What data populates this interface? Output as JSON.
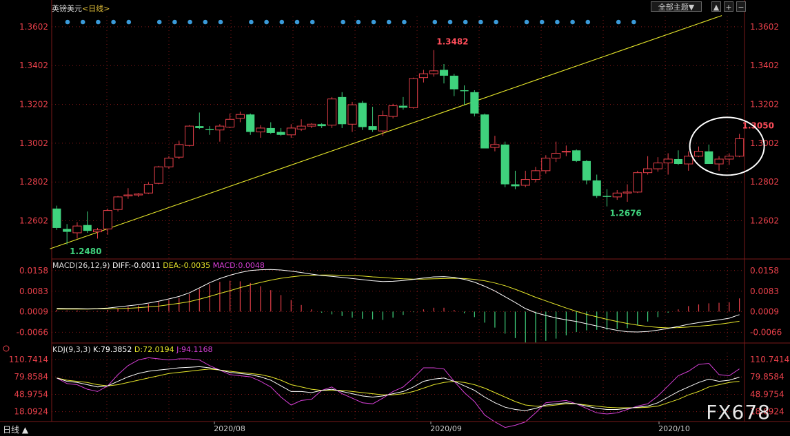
{
  "header": {
    "symbol": "英镑美元",
    "period_tag": "<日线>",
    "theme_button": "全部主题▼",
    "buttons": [
      "▲",
      "+",
      "−"
    ]
  },
  "macd_header": {
    "label": "MACD(26,12,9)",
    "diff": "DIFF:-0.0011",
    "dea": "DEA:-0.0035",
    "macd": "MACD:0.0048"
  },
  "kdj_header": {
    "label": "KDJ(9,3,3)",
    "k": "K:79.3852",
    "d": "D:72.0194",
    "j": "J:94.1168"
  },
  "footer": {
    "period": "日线 ▲",
    "x_ticks": [
      "2020/08",
      "2020/09",
      "2020/10"
    ]
  },
  "watermark": "FX678",
  "colors": {
    "up": "#e8404a",
    "down": "#3fd27d",
    "trend": "#e6e62a",
    "diff": "#ffffff",
    "dea": "#e6e62a",
    "k_line": "#ffffff",
    "d_line": "#e6e62a",
    "j_line": "#d63fd6",
    "axis_label": "#e8404a",
    "dots": "#3a9ad9"
  },
  "chart_data": [
    {
      "type": "candlestick",
      "title": "英镑美元",
      "x_ticks": [
        "2020/08",
        "2020/09",
        "2020/10"
      ],
      "y_ticks": [
        "1.3602",
        "1.3402",
        "1.3202",
        "1.3002",
        "1.2802",
        "1.2602"
      ],
      "ylim": [
        1.2405,
        1.3655
      ],
      "annotations": [
        {
          "text": "1.3482",
          "type": "high"
        },
        {
          "text": "1.2480",
          "type": "low"
        },
        {
          "text": "1.2676",
          "type": "low"
        },
        {
          "text": "1.3050",
          "type": "high",
          "circled": true
        }
      ],
      "trendline": {
        "from": [
          0,
          1.25
        ],
        "to": [
          65,
          1.366
        ]
      },
      "ohlc": [
        [
          1.2665,
          1.268,
          1.2555,
          1.2565
        ],
        [
          1.256,
          1.2585,
          1.248,
          1.2545
        ],
        [
          1.254,
          1.2595,
          1.251,
          1.2575
        ],
        [
          1.258,
          1.265,
          1.254,
          1.255
        ],
        [
          1.2545,
          1.2565,
          1.251,
          1.2555
        ],
        [
          1.256,
          1.2665,
          1.253,
          1.2655
        ],
        [
          1.266,
          1.273,
          1.265,
          1.2725
        ],
        [
          1.273,
          1.277,
          1.2715,
          1.2735
        ],
        [
          1.2735,
          1.2745,
          1.2725,
          1.274
        ],
        [
          1.2745,
          1.28,
          1.274,
          1.279
        ],
        [
          1.2795,
          1.2885,
          1.279,
          1.288
        ],
        [
          1.288,
          1.2935,
          1.287,
          1.2925
        ],
        [
          1.293,
          1.3015,
          1.292,
          1.2995
        ],
        [
          1.299,
          1.3095,
          1.2985,
          1.309
        ],
        [
          1.309,
          1.316,
          1.3075,
          1.308
        ],
        [
          1.3075,
          1.309,
          1.3045,
          1.307
        ],
        [
          1.307,
          1.31,
          1.301,
          1.309
        ],
        [
          1.3085,
          1.3155,
          1.308,
          1.3125
        ],
        [
          1.313,
          1.3165,
          1.311,
          1.315
        ],
        [
          1.315,
          1.3155,
          1.3045,
          1.306
        ],
        [
          1.306,
          1.3095,
          1.303,
          1.308
        ],
        [
          1.308,
          1.311,
          1.305,
          1.3055
        ],
        [
          1.306,
          1.308,
          1.304,
          1.3045
        ],
        [
          1.3045,
          1.31,
          1.303,
          1.308
        ],
        [
          1.3075,
          1.3125,
          1.3065,
          1.309
        ],
        [
          1.309,
          1.3105,
          1.308,
          1.31
        ],
        [
          1.31,
          1.3105,
          1.308,
          1.309
        ],
        [
          1.3095,
          1.324,
          1.308,
          1.323
        ],
        [
          1.324,
          1.3265,
          1.308,
          1.31
        ],
        [
          1.31,
          1.3215,
          1.306,
          1.32
        ],
        [
          1.321,
          1.322,
          1.307,
          1.3085
        ],
        [
          1.309,
          1.319,
          1.306,
          1.307
        ],
        [
          1.3065,
          1.317,
          1.304,
          1.3145
        ],
        [
          1.314,
          1.3205,
          1.313,
          1.3195
        ],
        [
          1.3195,
          1.324,
          1.3175,
          1.3185
        ],
        [
          1.3185,
          1.334,
          1.318,
          1.3335
        ],
        [
          1.334,
          1.338,
          1.3315,
          1.336
        ],
        [
          1.336,
          1.3482,
          1.3345,
          1.3375
        ],
        [
          1.338,
          1.341,
          1.331,
          1.335
        ],
        [
          1.335,
          1.336,
          1.3245,
          1.328
        ],
        [
          1.3275,
          1.33,
          1.32,
          1.327
        ],
        [
          1.3265,
          1.3275,
          1.314,
          1.3155
        ],
        [
          1.315,
          1.3155,
          1.298,
          1.2975
        ],
        [
          1.298,
          1.304,
          1.296,
          1.2995
        ],
        [
          1.2995,
          1.301,
          1.2775,
          1.279
        ],
        [
          1.279,
          1.286,
          1.2765,
          1.278
        ],
        [
          1.2785,
          1.286,
          1.2775,
          1.2815
        ],
        [
          1.2815,
          1.288,
          1.28,
          1.286
        ],
        [
          1.286,
          1.294,
          1.2845,
          1.2925
        ],
        [
          1.2925,
          1.301,
          1.2905,
          1.295
        ],
        [
          1.296,
          1.299,
          1.2935,
          1.296
        ],
        [
          1.2965,
          1.297,
          1.2905,
          1.291
        ],
        [
          1.291,
          1.2915,
          1.279,
          1.281
        ],
        [
          1.281,
          1.284,
          1.272,
          1.273
        ],
        [
          1.273,
          1.2765,
          1.2676,
          1.2725
        ],
        [
          1.2725,
          1.276,
          1.271,
          1.2745
        ],
        [
          1.2745,
          1.279,
          1.27,
          1.275
        ],
        [
          1.275,
          1.286,
          1.2745,
          1.285
        ],
        [
          1.285,
          1.2935,
          1.284,
          1.287
        ],
        [
          1.287,
          1.293,
          1.2855,
          1.29
        ],
        [
          1.29,
          1.295,
          1.284,
          1.292
        ],
        [
          1.292,
          1.2965,
          1.289,
          1.2895
        ],
        [
          1.2895,
          1.296,
          1.286,
          1.2935
        ],
        [
          1.2935,
          1.2985,
          1.293,
          1.296
        ],
        [
          1.296,
          1.2995,
          1.2905,
          1.2895
        ],
        [
          1.2895,
          1.2935,
          1.286,
          1.292
        ],
        [
          1.292,
          1.295,
          1.289,
          1.2935
        ],
        [
          1.2935,
          1.305,
          1.293,
          1.3025
        ]
      ]
    },
    {
      "type": "macd",
      "y_ticks": [
        "0.0158",
        "0.0083",
        "0.0009",
        "-0.0066"
      ],
      "ylim": [
        -0.01,
        0.017
      ],
      "diff": [
        0.0012,
        0.0011,
        0.0011,
        0.001,
        0.0011,
        0.0013,
        0.0017,
        0.0021,
        0.0025,
        0.0031,
        0.0038,
        0.0046,
        0.0055,
        0.0068,
        0.0086,
        0.0105,
        0.012,
        0.0132,
        0.0142,
        0.0149,
        0.0152,
        0.0153,
        0.0151,
        0.0147,
        0.0142,
        0.0136,
        0.0131,
        0.0128,
        0.0124,
        0.012,
        0.0116,
        0.0112,
        0.0109,
        0.011,
        0.0113,
        0.0117,
        0.0122,
        0.0126,
        0.0127,
        0.0124,
        0.0117,
        0.0107,
        0.0092,
        0.0075,
        0.0054,
        0.0033,
        0.0011,
        -0.0004,
        -0.0014,
        -0.0023,
        -0.003,
        -0.0036,
        -0.0044,
        -0.0052,
        -0.0061,
        -0.0068,
        -0.0073,
        -0.0074,
        -0.0072,
        -0.0067,
        -0.0061,
        -0.0054,
        -0.0046,
        -0.004,
        -0.0035,
        -0.003,
        -0.0024,
        -0.0011
      ],
      "dea": [
        0.0009,
        0.0009,
        0.0009,
        0.0009,
        0.001,
        0.001,
        0.0011,
        0.0012,
        0.0014,
        0.0017,
        0.002,
        0.0025,
        0.003,
        0.0036,
        0.0045,
        0.0055,
        0.0066,
        0.0076,
        0.0087,
        0.0097,
        0.0106,
        0.0114,
        0.0121,
        0.0126,
        0.013,
        0.0132,
        0.0133,
        0.0133,
        0.0132,
        0.0131,
        0.0129,
        0.0126,
        0.0124,
        0.0121,
        0.0119,
        0.0118,
        0.0118,
        0.0119,
        0.012,
        0.0121,
        0.012,
        0.0117,
        0.0112,
        0.0104,
        0.0094,
        0.0081,
        0.0067,
        0.0052,
        0.0039,
        0.0026,
        0.0013,
        0.0001,
        -0.001,
        -0.0019,
        -0.0028,
        -0.0036,
        -0.0043,
        -0.0049,
        -0.0054,
        -0.0057,
        -0.0059,
        -0.0058,
        -0.0056,
        -0.0053,
        -0.005,
        -0.0046,
        -0.0041,
        -0.0035
      ],
      "macd": [
        0.0006,
        0.0004,
        0.0004,
        0.0002,
        0.0002,
        0.0006,
        0.0012,
        0.0018,
        0.0022,
        0.0028,
        0.0036,
        0.0042,
        0.005,
        0.0064,
        0.0082,
        0.01,
        0.0108,
        0.0112,
        0.011,
        0.0104,
        0.0092,
        0.0078,
        0.006,
        0.0042,
        0.0024,
        0.0008,
        -0.0004,
        -0.001,
        -0.0016,
        -0.0022,
        -0.0026,
        -0.0028,
        -0.003,
        -0.0022,
        -0.0012,
        -0.0002,
        0.0008,
        0.0014,
        0.0014,
        0.0006,
        -0.0006,
        -0.002,
        -0.004,
        -0.0058,
        -0.008,
        -0.0096,
        -0.0112,
        -0.0112,
        -0.0106,
        -0.0098,
        -0.0086,
        -0.0074,
        -0.0068,
        -0.0066,
        -0.0066,
        -0.0064,
        -0.006,
        -0.005,
        -0.0036,
        -0.002,
        -0.0004,
        0.0008,
        0.002,
        0.0026,
        0.003,
        0.0032,
        0.0034,
        0.0048
      ]
    },
    {
      "type": "kdj",
      "y_ticks": [
        "110.7414",
        "79.8584",
        "48.9754",
        "18.0924"
      ],
      "ylim": [
        3,
        123
      ],
      "k": [
        78,
        72,
        70,
        66,
        62,
        64,
        72,
        80,
        86,
        90,
        92,
        94,
        96,
        97,
        98,
        96,
        92,
        88,
        86,
        84,
        80,
        74,
        64,
        54,
        54,
        52,
        56,
        58,
        54,
        50,
        46,
        44,
        46,
        50,
        54,
        62,
        72,
        76,
        78,
        72,
        64,
        56,
        44,
        34,
        26,
        22,
        20,
        24,
        30,
        32,
        34,
        32,
        28,
        24,
        22,
        22,
        24,
        26,
        28,
        34,
        44,
        54,
        62,
        70,
        76,
        72,
        74,
        79.4
      ],
      "d": [
        78,
        74,
        72,
        70,
        66,
        64,
        66,
        70,
        74,
        78,
        82,
        86,
        88,
        90,
        92,
        94,
        92,
        90,
        88,
        86,
        84,
        80,
        74,
        66,
        62,
        58,
        56,
        56,
        56,
        54,
        52,
        50,
        48,
        48,
        50,
        54,
        60,
        66,
        70,
        72,
        70,
        66,
        60,
        52,
        44,
        36,
        30,
        28,
        28,
        30,
        32,
        32,
        30,
        28,
        26,
        25,
        25,
        25,
        26,
        28,
        34,
        40,
        48,
        54,
        62,
        66,
        70,
        72.0
      ],
      "j": [
        78,
        68,
        66,
        58,
        54,
        64,
        84,
        100,
        110,
        114,
        112,
        110,
        112,
        112,
        110,
        100,
        92,
        84,
        82,
        80,
        72,
        62,
        44,
        30,
        38,
        40,
        56,
        62,
        50,
        42,
        34,
        32,
        42,
        54,
        62,
        78,
        96,
        96,
        94,
        72,
        52,
        36,
        12,
        0,
        -10,
        -6,
        0,
        16,
        34,
        36,
        38,
        32,
        24,
        16,
        14,
        16,
        22,
        28,
        32,
        46,
        64,
        82,
        90,
        102,
        104,
        84,
        82,
        94.1
      ]
    }
  ]
}
